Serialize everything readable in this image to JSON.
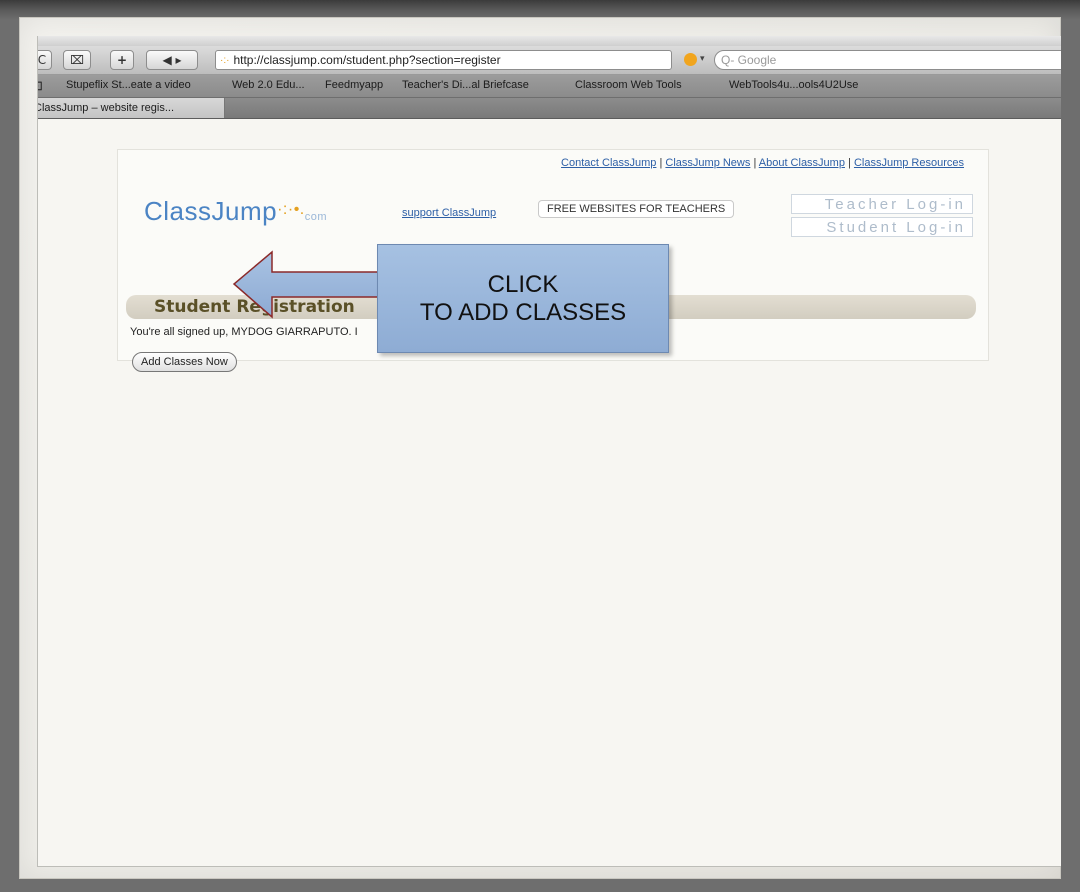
{
  "browser": {
    "url": "http://classjump.com/student.php?section=register",
    "search_placeholder": "Q- Google",
    "bookmarks": [
      "Stupeflix St...eate a video",
      "Web 2.0 Edu...",
      "Feedmyapp",
      "Teacher's Di...al Briefcase",
      "Classroom Web Tools",
      "WebTools4u...ools4U2Use"
    ],
    "tab_title": "ClassJump – website regis..."
  },
  "site": {
    "top_links": [
      "Contact ClassJump",
      "ClassJump News",
      "About ClassJump",
      "ClassJump Resources"
    ],
    "logo_text": "ClassJump",
    "logo_dots": "·:·•.",
    "logo_suffix": "com",
    "support_link": "support ClassJump",
    "free_badge": "FREE WEBSITES FOR TEACHERS",
    "teacher_login": "Teacher Log-in",
    "student_login": "Student Log-in"
  },
  "registration": {
    "title": "Student Registration",
    "message": "You're all signed up, MYDOG GIARRAPUTO. I",
    "add_button": "Add Classes Now"
  },
  "callout": {
    "line1": "CLICK",
    "line2": "TO ADD CLASSES"
  },
  "colors": {
    "callout_fill": "#97b4da",
    "callout_border": "#6d89b1",
    "arrow_border": "#8b2a2a",
    "link": "#2d5fa6",
    "logo": "#4b84c4"
  }
}
